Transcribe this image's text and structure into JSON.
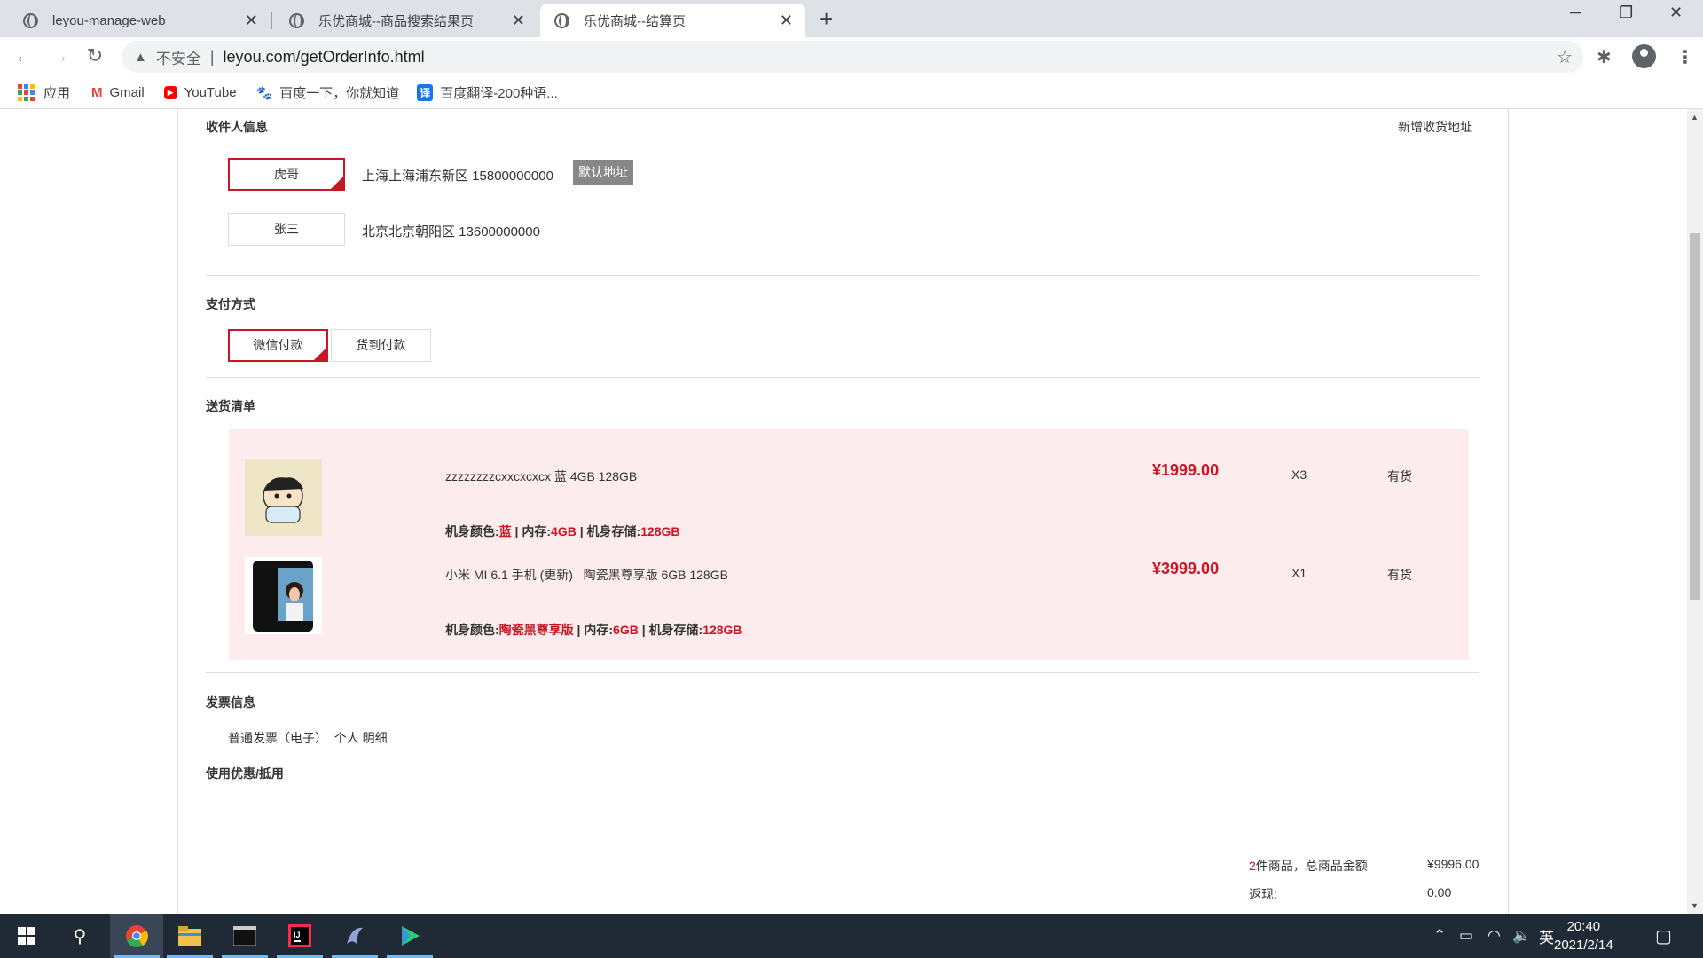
{
  "browser": {
    "tabs": [
      {
        "title": "leyou-manage-web"
      },
      {
        "title": "乐优商城--商品搜索结果页"
      },
      {
        "title": "乐优商城--结算页"
      }
    ],
    "security_label": "不安全",
    "url": "leyou.com/getOrderInfo.html",
    "bookmarks": [
      {
        "label": "应用",
        "icon": "apps-grid-icon"
      },
      {
        "label": "Gmail",
        "icon": "gmail-icon"
      },
      {
        "label": "YouTube",
        "icon": "youtube-icon"
      },
      {
        "label": "百度一下，你就知道",
        "icon": "baidu-paw-icon"
      },
      {
        "label": "百度翻译-200种语...",
        "icon": "baidu-translate-icon"
      }
    ]
  },
  "receiver": {
    "title": "收件人信息",
    "add_link": "新增收货地址",
    "addresses": [
      {
        "name": "虎哥",
        "detail": "上海上海浦东新区 15800000000",
        "badge": "默认地址",
        "selected": true
      },
      {
        "name": "张三",
        "detail": "北京北京朝阳区 13600000000",
        "selected": false
      }
    ]
  },
  "payment": {
    "title": "支付方式",
    "options": [
      {
        "label": "微信付款",
        "selected": true
      },
      {
        "label": "货到付款",
        "selected": false
      }
    ]
  },
  "delivery": {
    "title": "送货清单",
    "items": [
      {
        "name": "zzzzzzzzcxxcxcxcx 蓝 4GB 128GB",
        "spec_color_label": "机身颜色:",
        "spec_color": "蓝",
        "spec_mem_label": " | 内存:",
        "spec_mem": "4GB",
        "spec_storage_label": " | 机身存储:",
        "spec_storage": "128GB",
        "price": "¥1999.00",
        "qty": "X3",
        "stock": "有货"
      },
      {
        "name": "小米 MI 6.1 手机 (更新)   陶瓷黑尊享版 6GB 128GB",
        "spec_color_label": "机身颜色:",
        "spec_color": "陶瓷黑尊享版",
        "spec_mem_label": " | 内存:",
        "spec_mem": "6GB",
        "spec_storage_label": " | 机身存储:",
        "spec_storage": "128GB",
        "price": "¥3999.00",
        "qty": "X1",
        "stock": "有货"
      }
    ]
  },
  "invoice": {
    "title": "发票信息",
    "text": "普通发票（电子）  个人 明细"
  },
  "coupon": {
    "title": "使用优惠/抵用"
  },
  "summary": {
    "count": "2",
    "count_suffix": "件商品，总商品金额",
    "total": "¥9996.00",
    "cashback_label": "返现:",
    "cashback": "0.00"
  },
  "taskbar": {
    "time": "20:40",
    "date": "2021/2/14",
    "ime": "英"
  },
  "colors": {
    "accent": "#c81623",
    "list_bg": "#fdecee"
  }
}
